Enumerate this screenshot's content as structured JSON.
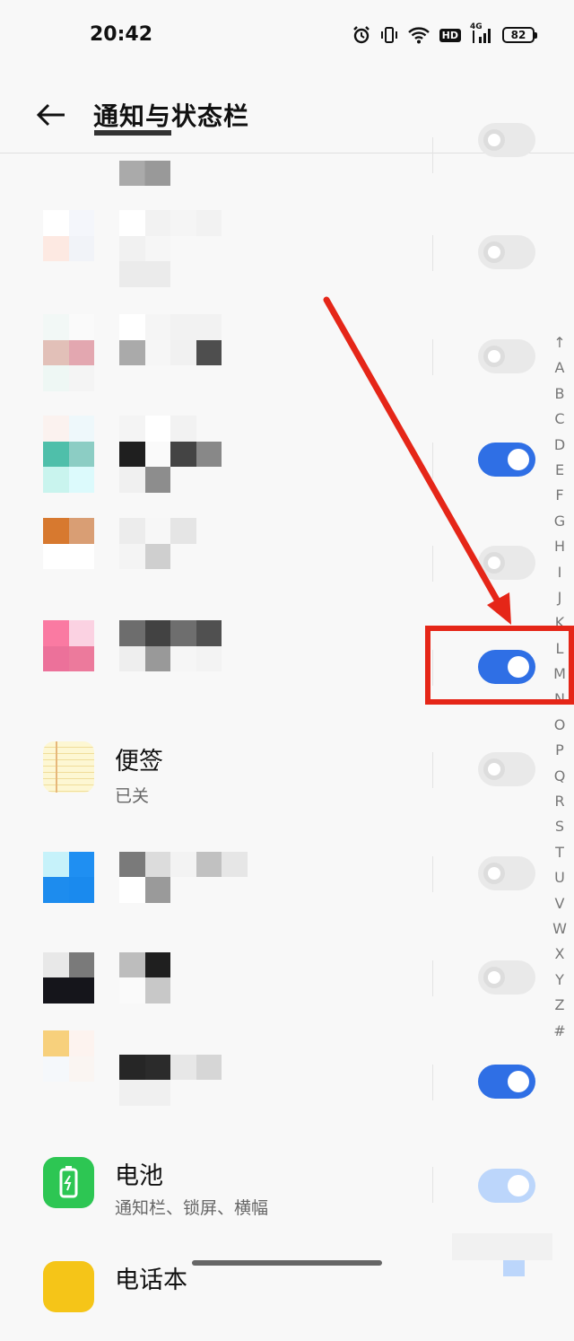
{
  "status_bar": {
    "time": "20:42",
    "hd_badge": "HD",
    "network": "4G",
    "battery": "82"
  },
  "header": {
    "title": "通知与状态栏"
  },
  "rows": [
    {
      "name": "",
      "sub": "",
      "toggle": "off"
    },
    {
      "name": "",
      "sub": "",
      "toggle": "off"
    },
    {
      "name": "",
      "sub": "",
      "toggle": "off"
    },
    {
      "name": "",
      "sub": "",
      "toggle": "on"
    },
    {
      "name": "",
      "sub": "",
      "toggle": "off"
    },
    {
      "name": "",
      "sub": "",
      "toggle": "on"
    },
    {
      "name": "便签",
      "sub": "已关",
      "toggle": "off"
    },
    {
      "name": "",
      "sub": "",
      "toggle": "off"
    },
    {
      "name": "",
      "sub": "",
      "toggle": "off"
    },
    {
      "name": "",
      "sub": "",
      "toggle": "on"
    },
    {
      "name": "电池",
      "sub": "通知栏、锁屏、横幅",
      "toggle": "on-light"
    },
    {
      "name": "电话本",
      "sub": "",
      "toggle": "on-light"
    }
  ],
  "alphabet": [
    "↑",
    "A",
    "B",
    "C",
    "D",
    "E",
    "F",
    "G",
    "H",
    "I",
    "J",
    "K",
    "L",
    "M",
    "N",
    "O",
    "P",
    "Q",
    "R",
    "S",
    "T",
    "U",
    "V",
    "W",
    "X",
    "Y",
    "Z",
    "#"
  ],
  "colors": {
    "toggle_on": "#2f6fe5",
    "annotation": "#e52618",
    "battery_icon": "#2dc653",
    "phonebook_icon": "#f5c518"
  }
}
